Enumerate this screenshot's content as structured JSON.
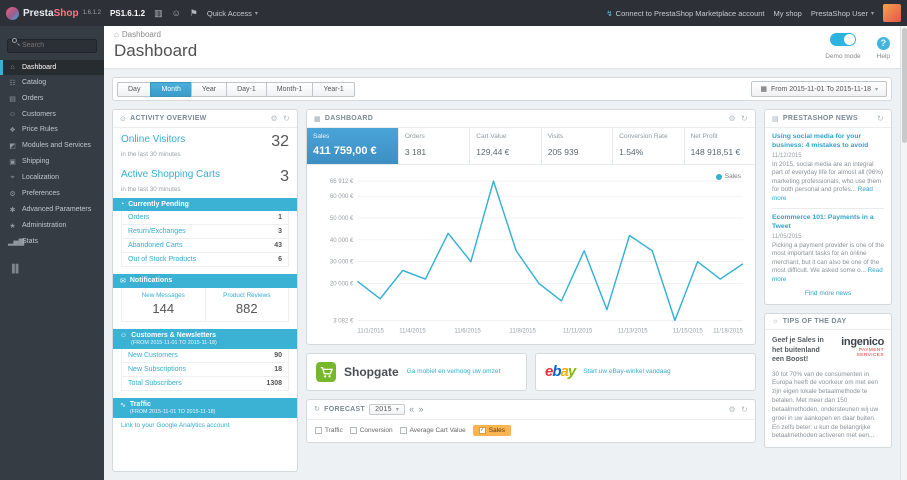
{
  "colors": {
    "accent_blue": "#3bb1d4",
    "link_blue": "#2fa3cc",
    "kpi_active_blue": "#3d8fc2",
    "forecast_highlight_orange": "#fbb450",
    "chart_line": "#31b0d5",
    "sidebar_dark": "#363c44",
    "topbar_dark": "#2d3137"
  },
  "icons": {
    "cart": "▥",
    "person": "☺",
    "megaphone": "⚑",
    "caret": "▾",
    "bolt": "↯",
    "home": "⌂",
    "catalog": "☷",
    "orders": "▤",
    "customers": "☺",
    "price_rules": "❖",
    "modules": "◩",
    "shipping": "▣",
    "localization": "⌖",
    "preferences": "⚙",
    "advanced_parameters": "✱",
    "administration": "★",
    "stats": "▂▅▇",
    "collapse": "▐▌",
    "gear": "⚙",
    "refresh": "↻",
    "calendar": "▦",
    "activity": "⊙",
    "clock": "◔",
    "envelope": "✉",
    "group": "☺",
    "traffic": "∿",
    "dashboard": "▦",
    "forecast": "↻",
    "news": "▤",
    "tips": "☼",
    "prev": "«",
    "next": "»",
    "check": "✓",
    "help": "?"
  },
  "topbar": {
    "logo_presta": "Presta",
    "logo_shop": "Shop",
    "version": "1.6.1.2",
    "shop_name": "PS1.6.1.2",
    "quick_access": "Quick Access",
    "marketplace_link": "Connect to PrestaShop Marketplace account",
    "my_shop": "My shop",
    "user": "PrestaShop User"
  },
  "sidebar": {
    "search_placeholder": "Search",
    "items": [
      {
        "label": "Dashboard"
      },
      {
        "label": "Catalog"
      },
      {
        "label": "Orders"
      },
      {
        "label": "Customers"
      },
      {
        "label": "Price Rules"
      },
      {
        "label": "Modules and Services"
      },
      {
        "label": "Shipping"
      },
      {
        "label": "Localization"
      },
      {
        "label": "Preferences"
      },
      {
        "label": "Advanced Parameters"
      },
      {
        "label": "Administration"
      },
      {
        "label": "Stats"
      }
    ]
  },
  "header": {
    "breadcrumb": "Dashboard",
    "title": "Dashboard",
    "demo_mode": "Demo mode",
    "help": "Help"
  },
  "filters": {
    "buttons": [
      "Day",
      "Month",
      "Year",
      "Day-1",
      "Month-1",
      "Year-1"
    ],
    "active": "Month",
    "date_range": "From 2015-11-01 To 2015-11-18"
  },
  "activity": {
    "title": "ACTIVITY OVERVIEW",
    "online_visitors": {
      "label": "Online Visitors",
      "value": "32",
      "sub": "in the last 30 minutes"
    },
    "active_carts": {
      "label": "Active Shopping Carts",
      "value": "3",
      "sub": "in the last 30 minutes"
    },
    "pending": {
      "title": "Currently Pending",
      "rows": [
        {
          "label": "Orders",
          "value": "1"
        },
        {
          "label": "Return/Exchanges",
          "value": "3"
        },
        {
          "label": "Abandoned Carts",
          "value": "43"
        },
        {
          "label": "Out of Stock Products",
          "value": "6"
        }
      ]
    },
    "notifications": {
      "title": "Notifications",
      "cols": [
        {
          "label": "New Messages",
          "value": "144"
        },
        {
          "label": "Product Reviews",
          "value": "882"
        }
      ]
    },
    "customers": {
      "title": "Customers & Newsletters",
      "subtitle": "(FROM 2015-11-01 TO 2015-11-18)",
      "rows": [
        {
          "label": "New Customers",
          "value": "90"
        },
        {
          "label": "New Subscriptions",
          "value": "18"
        },
        {
          "label": "Total Subscribers",
          "value": "1308"
        }
      ]
    },
    "traffic": {
      "title": "Traffic",
      "subtitle": "(FROM 2015-11-01 TO 2015-11-18)",
      "link": "Link to your Google Analytics account"
    }
  },
  "dashboard_panel": {
    "title": "DASHBOARD",
    "kpis": [
      {
        "label": "Sales",
        "value": "411 759,00 €"
      },
      {
        "label": "Orders",
        "value": "3 181"
      },
      {
        "label": "Cart Value",
        "value": "129,44 €"
      },
      {
        "label": "Visits",
        "value": "205 939"
      },
      {
        "label": "Conversion Rate",
        "value": "1.54%"
      },
      {
        "label": "Net Profit",
        "value": "148 918,51 €"
      }
    ],
    "legend": "Sales"
  },
  "chart_data": {
    "type": "line",
    "title": "Sales (Month view, 2015-11-01 to 2015-11-18)",
    "series": [
      {
        "name": "Sales",
        "values": [
          21000,
          13000,
          26000,
          22000,
          43000,
          30000,
          66912,
          35000,
          20000,
          12000,
          35000,
          8000,
          42000,
          35000,
          3082,
          30000,
          22000,
          29000
        ]
      }
    ],
    "x_labels": [
      "11/1/2015",
      "11/4/2015",
      "11/6/2015",
      "11/8/2015",
      "11/11/2015",
      "11/13/2015",
      "11/15/2015",
      "11/18/2015"
    ],
    "y_ticks": [
      3082,
      20000,
      30000,
      40000,
      50000,
      60000,
      66912
    ],
    "y_tick_labels": [
      "3 082 €",
      "20 000 €",
      "30 000 €",
      "40 000 €",
      "50 000 €",
      "60 000 €",
      "66 912 €"
    ],
    "ylim": [
      3082,
      66912
    ],
    "grid": true,
    "legend": [
      "Sales"
    ],
    "legend_position": "top-right",
    "line_color": "#31b0d5"
  },
  "promos": {
    "shopgate": {
      "brand": "Shopgate",
      "link": "Ga mobiel en verhoog uw omzet"
    },
    "ebay": {
      "letters": [
        "e",
        "b",
        "a",
        "y"
      ],
      "link": "Start uw eBay-winkel vandaag"
    }
  },
  "forecast": {
    "title": "FORECAST",
    "year": "2015",
    "legend": [
      {
        "label": "Traffic"
      },
      {
        "label": "Conversion"
      },
      {
        "label": "Average Cart Value"
      },
      {
        "label": "Sales",
        "active": true
      }
    ]
  },
  "news": {
    "title": "PRESTASHOP NEWS",
    "items": [
      {
        "title": "Using social media for your business: 4 mistakes to avoid",
        "date": "11/12/2015",
        "excerpt": "In 2015, social media are an integral part of everyday life for almost all (96%) marketing professionals, who use them for both personal and profes...",
        "read_more": "Read more"
      },
      {
        "title": "Ecommerce 101: Payments in a Tweet",
        "date": "11/05/2015",
        "excerpt": "Picking a payment provider is one of the most important tasks for an online merchant, but it can also be one of the most difficult. We asked some o...",
        "read_more": "Read more"
      }
    ],
    "more": "Find more news"
  },
  "tips": {
    "title": "TIPS OF THE DAY",
    "headline": "Geef je Sales in het buitenland een Boost!",
    "brand": "ingenico",
    "brand_sub": "PAYMENT SERVICES",
    "body": "30 tot 70% van de consumenten in Europa heeft de voorkeur om met een zijn eigen lokale betaalmethode te betalen. Met meer dan 150 betaalmethoden, ondersteunen wij uw groei in uw aankopen en daar buiten. En zelfs beter: u kun de belangrijke betaalmethoden activeren met een..."
  }
}
